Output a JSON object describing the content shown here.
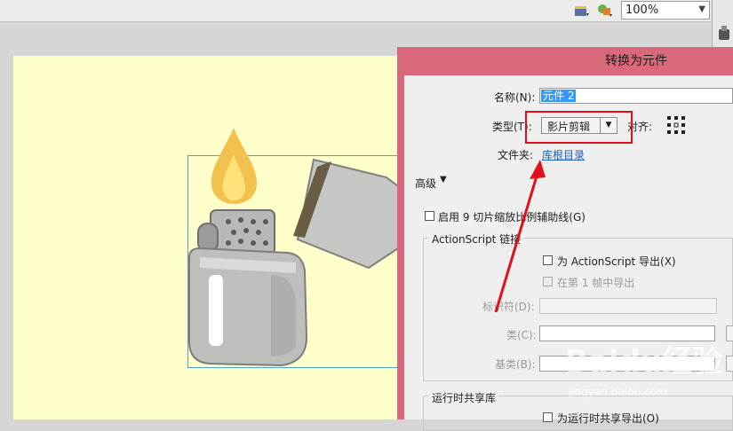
{
  "toolbar": {
    "zoom_value": "100%",
    "icons": [
      "scene-icon",
      "symbol-icon"
    ]
  },
  "dialog": {
    "title": "转换为元件",
    "name_label": "名称(N):",
    "name_value": "元件 2",
    "type_label": "类型(T):",
    "type_value": "影片剪辑",
    "align_label": "对齐:",
    "folder_label": "文件夹:",
    "folder_link": "库根目录",
    "advanced_label": "高级",
    "guides_label": "启用 9 切片缩放比例辅助线(G)",
    "actionscript_group": "ActionScript 链接",
    "export_as_label": "为 ActionScript 导出(X)",
    "export_frame_label": "在第 1 帧中导出",
    "identifier_label": "标识符(D):",
    "class_label": "类(C):",
    "base_class_label": "基类(B):",
    "runtime_group": "运行时共享库",
    "runtime_export_label": "为运行时共享导出(O)"
  },
  "watermark": {
    "text": "Baidu经验",
    "url_text": "jingyan.baidu.com"
  },
  "colors": {
    "dialog_frame": "#d9697a",
    "stage": "#ffffcc",
    "highlight_box": "#e00f1a",
    "link": "#1e5fb4"
  }
}
